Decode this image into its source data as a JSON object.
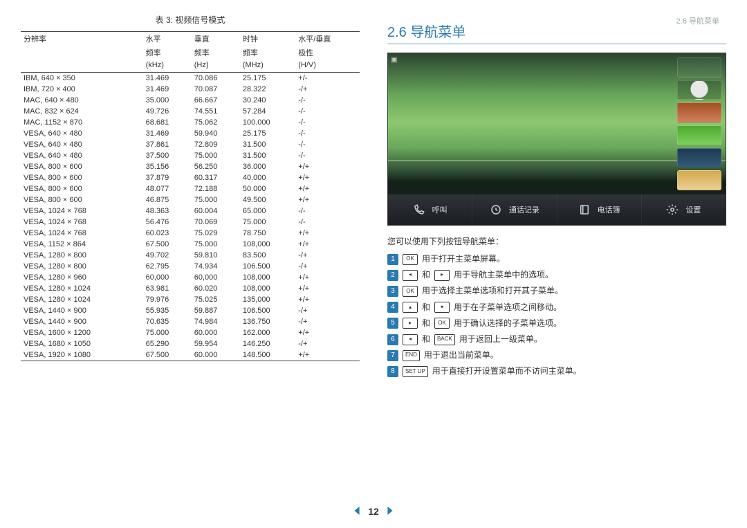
{
  "header": {
    "crumb": "2.6 导航菜单"
  },
  "table": {
    "title": "表 3: 视频信号模式",
    "headers": {
      "c0": "分辨率",
      "c1a": "水平",
      "c1b": "频率",
      "c1c": "(kHz)",
      "c2a": "垂直",
      "c2b": "频率",
      "c2c": "(Hz)",
      "c3a": "时钟",
      "c3b": "频率",
      "c3c": "(MHz)",
      "c4a": "水平/垂直",
      "c4b": "极性",
      "c4c": "(H/V)"
    },
    "rows": [
      {
        "res": "IBM, 640 × 350",
        "h": "31.469",
        "v": "70.086",
        "clk": "25.175",
        "pol": "+/-"
      },
      {
        "res": "IBM, 720 × 400",
        "h": "31.469",
        "v": "70.087",
        "clk": "28.322",
        "pol": "-/+"
      },
      {
        "res": "MAC, 640 × 480",
        "h": "35.000",
        "v": "66.667",
        "clk": "30.240",
        "pol": "-/-"
      },
      {
        "res": "MAC, 832 × 624",
        "h": "49.726",
        "v": "74.551",
        "clk": "57.284",
        "pol": "-/-"
      },
      {
        "res": "MAC, 1152 × 870",
        "h": "68.681",
        "v": "75.062",
        "clk": "100.000",
        "pol": "-/-"
      },
      {
        "res": "VESA, 640 × 480",
        "h": "31.469",
        "v": "59.940",
        "clk": "25.175",
        "pol": "-/-"
      },
      {
        "res": "VESA, 640 × 480",
        "h": "37.861",
        "v": "72.809",
        "clk": "31.500",
        "pol": "-/-"
      },
      {
        "res": "VESA, 640 × 480",
        "h": "37.500",
        "v": "75.000",
        "clk": "31.500",
        "pol": "-/-"
      },
      {
        "res": "VESA, 800 × 600",
        "h": "35.156",
        "v": "56.250",
        "clk": "36.000",
        "pol": "+/+"
      },
      {
        "res": "VESA, 800 × 600",
        "h": "37.879",
        "v": "60.317",
        "clk": "40.000",
        "pol": "+/+"
      },
      {
        "res": "VESA, 800 × 600",
        "h": "48.077",
        "v": "72.188",
        "clk": "50.000",
        "pol": "+/+"
      },
      {
        "res": "VESA, 800 × 600",
        "h": "46.875",
        "v": "75.000",
        "clk": "49.500",
        "pol": "+/+"
      },
      {
        "res": "VESA, 1024 × 768",
        "h": "48.363",
        "v": "60.004",
        "clk": "65.000",
        "pol": "-/-"
      },
      {
        "res": "VESA, 1024 × 768",
        "h": "56.476",
        "v": "70.069",
        "clk": "75.000",
        "pol": "-/-"
      },
      {
        "res": "VESA, 1024 × 768",
        "h": "60.023",
        "v": "75.029",
        "clk": "78.750",
        "pol": "+/+"
      },
      {
        "res": "VESA, 1152 × 864",
        "h": "67.500",
        "v": "75.000",
        "clk": "108,000",
        "pol": "+/+"
      },
      {
        "res": "VESA, 1280 × 800",
        "h": "49.702",
        "v": "59.810",
        "clk": "83.500",
        "pol": "-/+"
      },
      {
        "res": "VESA, 1280 × 800",
        "h": "62.795",
        "v": "74.934",
        "clk": "106.500",
        "pol": "-/+"
      },
      {
        "res": "VESA, 1280 × 960",
        "h": "60,000",
        "v": "60,000",
        "clk": "108,000",
        "pol": "+/+"
      },
      {
        "res": "VESA, 1280 × 1024",
        "h": "63.981",
        "v": "60.020",
        "clk": "108,000",
        "pol": "+/+"
      },
      {
        "res": "VESA, 1280 × 1024",
        "h": "79.976",
        "v": "75.025",
        "clk": "135,000",
        "pol": "+/+"
      },
      {
        "res": "VESA, 1440 × 900",
        "h": "55.935",
        "v": "59.887",
        "clk": "106.500",
        "pol": "-/+"
      },
      {
        "res": "VESA, 1440 × 900",
        "h": "70.635",
        "v": "74.984",
        "clk": "136.750",
        "pol": "-/+"
      },
      {
        "res": "VESA, 1600 × 1200",
        "h": "75.000",
        "v": "60.000",
        "clk": "162.000",
        "pol": "+/+"
      },
      {
        "res": "VESA, 1680 × 1050",
        "h": "65.290",
        "v": "59.954",
        "clk": "146.250",
        "pol": "-/+"
      },
      {
        "res": "VESA, 1920 × 1080",
        "h": "67.500",
        "v": "60.000",
        "clk": "148.500",
        "pol": "+/+"
      }
    ]
  },
  "section": {
    "title": "2.6  导航菜单"
  },
  "screenshot_menu": {
    "items": [
      "呼叫",
      "通话记录",
      "电话簿",
      "设置"
    ]
  },
  "instructions": {
    "lead": "您可以使用下列按钮导航菜单：",
    "items": [
      {
        "n": "1",
        "keys": [
          {
            "t": "OK"
          }
        ],
        "text": "用于打开主菜单屏幕。"
      },
      {
        "n": "2",
        "keys": [
          {
            "t": "◂"
          },
          {
            "join": "和"
          },
          {
            "t": "▸"
          }
        ],
        "text": "用于导航主菜单中的选项。"
      },
      {
        "n": "3",
        "keys": [
          {
            "t": "OK"
          }
        ],
        "text": "用于选择主菜单选项和打开其子菜单。"
      },
      {
        "n": "4",
        "keys": [
          {
            "t": "▴"
          },
          {
            "join": "和"
          },
          {
            "t": "▾"
          }
        ],
        "text": "用于在子菜单选项之间移动。"
      },
      {
        "n": "5",
        "keys": [
          {
            "t": "▸"
          },
          {
            "join": "和"
          },
          {
            "t": "OK"
          }
        ],
        "text": "用于确认选择的子菜单选项。"
      },
      {
        "n": "6",
        "keys": [
          {
            "t": "◂"
          },
          {
            "join": "和"
          },
          {
            "t": "BACK"
          }
        ],
        "text": "用于返回上一级菜单。"
      },
      {
        "n": "7",
        "keys": [
          {
            "t": "END"
          }
        ],
        "text": "用于退出当前菜单。"
      },
      {
        "n": "8",
        "keys": [
          {
            "t": "SET UP"
          }
        ],
        "text": "用于直接打开设置菜单而不访问主菜单。"
      }
    ]
  },
  "pager": {
    "page": "12"
  }
}
